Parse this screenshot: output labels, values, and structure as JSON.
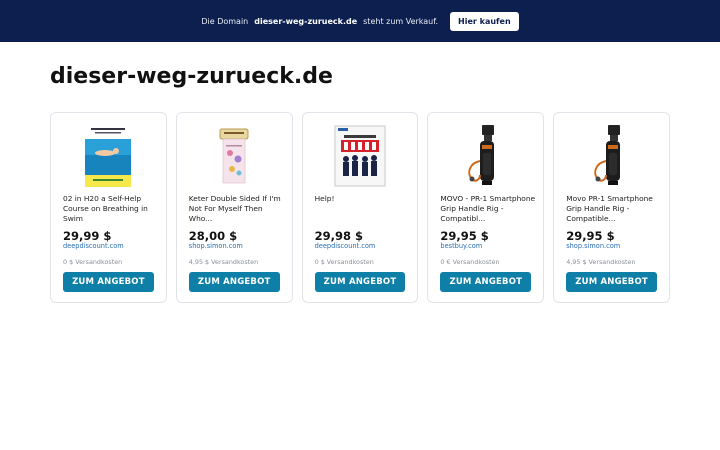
{
  "banner": {
    "prefix": "Die Domain",
    "domain": "dieser-weg-zurueck.de",
    "suffix": "steht zum Verkauf.",
    "button_label": "Hier kaufen"
  },
  "page_title": "dieser-weg-zurueck.de",
  "products": [
    {
      "title": "02 in H20 a Self-Help Course on Breathing in Swim",
      "price": "29,99 $",
      "shop": "deepdiscount.com",
      "shipping": "0 $ Versandkosten",
      "cta": "ZUM ANGEBOT",
      "image_icon": "swimmer-book-cover-icon"
    },
    {
      "title": "Keter Double Sided If I'm Not For Myself Then Who...",
      "price": "28,00 $",
      "shop": "shop.simon.com",
      "shipping": "4,95 $ Versandkosten",
      "cta": "ZUM ANGEBOT",
      "image_icon": "decorative-card-icon"
    },
    {
      "title": "Help!",
      "price": "29,98 $",
      "shop": "deepdiscount.com",
      "shipping": "0 $ Versandkosten",
      "cta": "ZUM ANGEBOT",
      "image_icon": "album-cover-icon"
    },
    {
      "title": "MOVO - PR-1 Smartphone Grip Handle Rig - Compatibl...",
      "price": "29,95 $",
      "shop": "bestbuy.com",
      "shipping": "0 € Versandkosten",
      "cta": "ZUM ANGEBOT",
      "image_icon": "camera-grip-icon"
    },
    {
      "title": "Movo PR-1 Smartphone Grip Handle Rig - Compatible...",
      "price": "29,95 $",
      "shop": "shop.simon.com",
      "shipping": "4,95 $ Versandkosten",
      "cta": "ZUM ANGEBOT",
      "image_icon": "camera-grip-icon"
    }
  ],
  "colors": {
    "banner_bg": "#0c1f4f",
    "cta_bg": "#0e7fa6",
    "shop_link": "#2a6fb3"
  }
}
